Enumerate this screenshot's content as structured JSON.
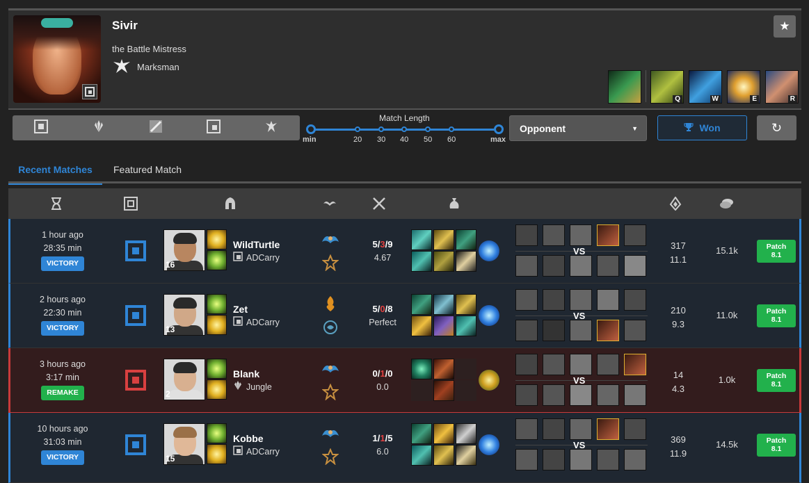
{
  "champion": {
    "name": "Sivir",
    "title": "the Battle Mistress",
    "role": "Marksman",
    "abilities": [
      {
        "key": "",
        "icon": "passive-ricochet-icon",
        "color": "#2f6a3a"
      },
      {
        "key": "Q",
        "icon": "boomerang-blade-icon",
        "color": "#7a8b2f"
      },
      {
        "key": "W",
        "icon": "ricochet-icon",
        "color": "#1e6fb0"
      },
      {
        "key": "E",
        "icon": "spell-shield-icon",
        "color": "#e0b040"
      },
      {
        "key": "R",
        "icon": "on-the-hunt-icon",
        "color": "#4a7aa0"
      }
    ]
  },
  "filters": {
    "match_length_label": "Match Length",
    "ticks": [
      "min",
      "20",
      "30",
      "40",
      "50",
      "60",
      "max"
    ],
    "opponent_label": "Opponent",
    "won_label": "Won"
  },
  "tabs": {
    "recent": "Recent Matches",
    "featured": "Featured Match"
  },
  "colors": {
    "accent": "#2f85d6",
    "win_row": "#1f2731",
    "loss_row": "#331c1d",
    "green": "#22b14c",
    "red": "#c83a3a"
  },
  "matches": [
    {
      "time_ago": "1 hour ago",
      "duration": "28:35 min",
      "result": "VICTORY",
      "player": "WildTurtle",
      "level": "16",
      "position": "ADCarry",
      "kills": "5",
      "deaths": "3",
      "assists": "9",
      "ratio": "4.67",
      "cs": "317",
      "cs_per_min": "11.1",
      "gold": "15.1k",
      "patch_label": "Patch",
      "patch_version": "8.1"
    },
    {
      "time_ago": "2 hours ago",
      "duration": "22:30 min",
      "result": "VICTORY",
      "player": "Zet",
      "level": "13",
      "position": "ADCarry",
      "kills": "5",
      "deaths": "0",
      "assists": "8",
      "ratio": "Perfect",
      "cs": "210",
      "cs_per_min": "9.3",
      "gold": "11.0k",
      "patch_label": "Patch",
      "patch_version": "8.1"
    },
    {
      "time_ago": "3 hours ago",
      "duration": "3:17 min",
      "result": "REMAKE",
      "player": "Blank",
      "level": "2",
      "position": "Jungle",
      "kills": "0",
      "deaths": "1",
      "assists": "0",
      "ratio": "0.0",
      "cs": "14",
      "cs_per_min": "4.3",
      "gold": "1.0k",
      "patch_label": "Patch",
      "patch_version": "8.1"
    },
    {
      "time_ago": "10 hours ago",
      "duration": "31:03 min",
      "result": "VICTORY",
      "player": "Kobbe",
      "level": "15",
      "position": "ADCarry",
      "kills": "1",
      "deaths": "1",
      "assists": "5",
      "ratio": "6.0",
      "cs": "369",
      "cs_per_min": "11.9",
      "gold": "14.5k",
      "patch_label": "Patch",
      "patch_version": "8.1"
    }
  ],
  "vs_label": "VS"
}
